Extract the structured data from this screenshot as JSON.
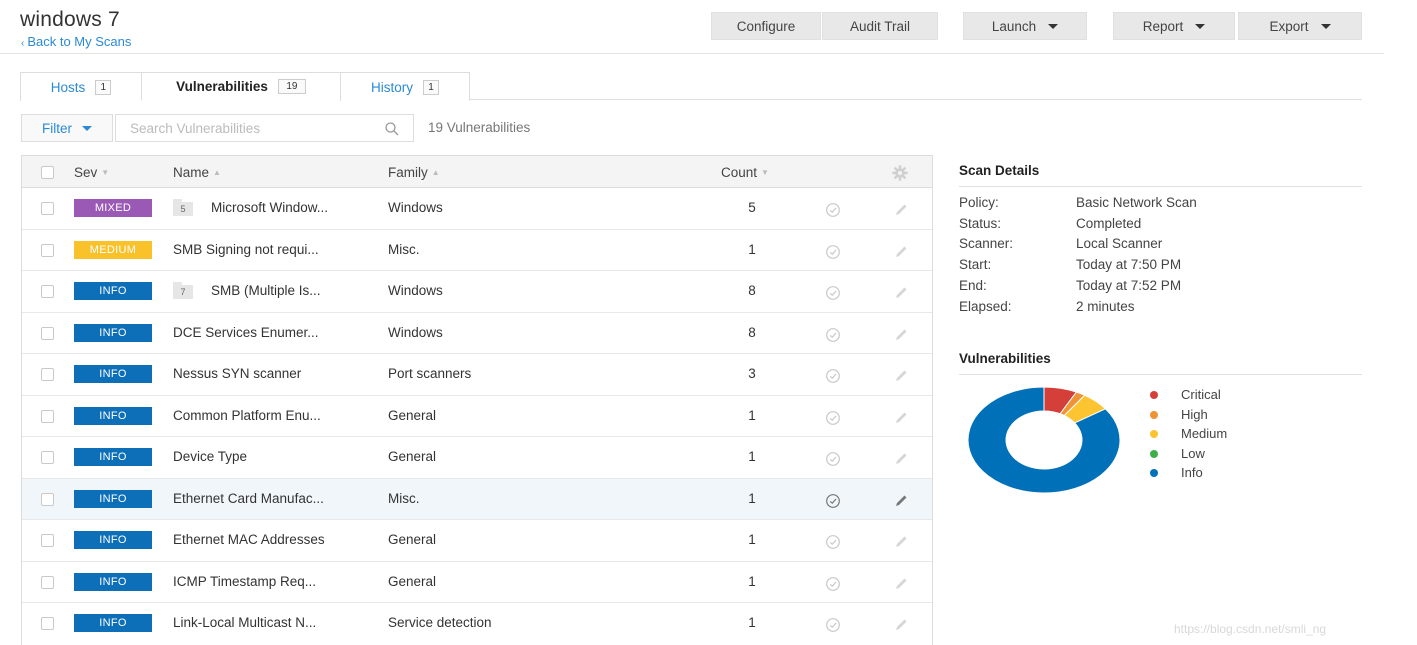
{
  "header": {
    "title": "windows 7",
    "back_link": "Back to My Scans",
    "buttons": {
      "configure": "Configure",
      "audit_trail": "Audit Trail",
      "launch": "Launch",
      "report": "Report",
      "export": "Export"
    }
  },
  "tabs": [
    {
      "label": "Hosts",
      "count": "1"
    },
    {
      "label": "Vulnerabilities",
      "count": "19"
    },
    {
      "label": "History",
      "count": "1"
    }
  ],
  "filter": {
    "button_label": "Filter",
    "search_placeholder": "Search Vulnerabilities",
    "result_count": "19 Vulnerabilities"
  },
  "table": {
    "columns": {
      "sev": "Sev",
      "name": "Name",
      "family": "Family",
      "count": "Count"
    },
    "rows": [
      {
        "sev": "MIXED",
        "sev_color": "#9b59b6",
        "group": "5",
        "name": "Microsoft Window...",
        "family": "Windows",
        "count": "5"
      },
      {
        "sev": "MEDIUM",
        "sev_color": "#f9c22b",
        "group": "",
        "name": "SMB Signing not requi...",
        "family": "Misc.",
        "count": "1"
      },
      {
        "sev": "INFO",
        "sev_color": "#0d6fb8",
        "group": "7",
        "name": "SMB (Multiple Is...",
        "family": "Windows",
        "count": "8"
      },
      {
        "sev": "INFO",
        "sev_color": "#0d6fb8",
        "group": "",
        "name": "DCE Services Enumer...",
        "family": "Windows",
        "count": "8"
      },
      {
        "sev": "INFO",
        "sev_color": "#0d6fb8",
        "group": "",
        "name": "Nessus SYN scanner",
        "family": "Port scanners",
        "count": "3"
      },
      {
        "sev": "INFO",
        "sev_color": "#0d6fb8",
        "group": "",
        "name": "Common Platform Enu...",
        "family": "General",
        "count": "1"
      },
      {
        "sev": "INFO",
        "sev_color": "#0d6fb8",
        "group": "",
        "name": "Device Type",
        "family": "General",
        "count": "1"
      },
      {
        "sev": "INFO",
        "sev_color": "#0d6fb8",
        "group": "",
        "name": "Ethernet Card Manufac...",
        "family": "Misc.",
        "count": "1",
        "highlighted": true
      },
      {
        "sev": "INFO",
        "sev_color": "#0d6fb8",
        "group": "",
        "name": "Ethernet MAC Addresses",
        "family": "General",
        "count": "1"
      },
      {
        "sev": "INFO",
        "sev_color": "#0d6fb8",
        "group": "",
        "name": "ICMP Timestamp Req...",
        "family": "General",
        "count": "1"
      },
      {
        "sev": "INFO",
        "sev_color": "#0d6fb8",
        "group": "",
        "name": "Link-Local Multicast N...",
        "family": "Service detection",
        "count": "1"
      }
    ]
  },
  "scan_details": {
    "heading": "Scan Details",
    "items": [
      {
        "key": "Policy:",
        "value": "Basic Network Scan"
      },
      {
        "key": "Status:",
        "value": "Completed"
      },
      {
        "key": "Scanner:",
        "value": "Local Scanner"
      },
      {
        "key": "Start:",
        "value": "Today at 7:50 PM"
      },
      {
        "key": "End:",
        "value": "Today at 7:52 PM"
      },
      {
        "key": "Elapsed:",
        "value": "2 minutes"
      }
    ]
  },
  "vulnerabilities_panel": {
    "heading": "Vulnerabilities"
  },
  "chart_data": {
    "type": "pie",
    "variant": "donut",
    "legend_position": "right",
    "categories": [
      "Critical",
      "High",
      "Medium",
      "Low",
      "Info"
    ],
    "values": [
      7,
      2,
      6,
      0,
      85
    ],
    "colors": [
      "#d43f3a",
      "#ee9336",
      "#fdc431",
      "#3fae49",
      "#0071b9"
    ]
  },
  "watermark": "https://blog.csdn.net/smli_ng"
}
